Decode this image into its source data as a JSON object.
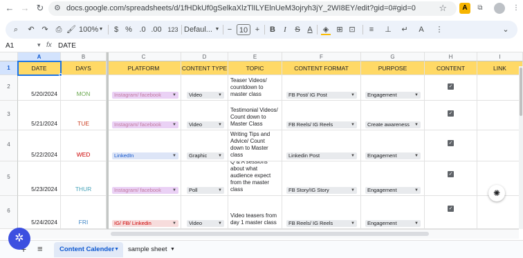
{
  "browser": {
    "url": "docs.google.com/spreadsheets/d/1fHDkUf0gSelkaXlzTlILYElnUeM3ojryh3jY_2WI8EY/edit?gid=0#gid=0"
  },
  "toolbar": {
    "zoom": "100%",
    "currency": "$",
    "percent": "%",
    "decrease_decimal": ".0",
    "increase_decimal": ".00",
    "number_format": "123",
    "font": "Defaul...",
    "font_size": "10"
  },
  "formula_bar": {
    "cell_ref": "A1",
    "content": "DATE"
  },
  "columns": [
    {
      "letter": "A",
      "header": "DATE"
    },
    {
      "letter": "B",
      "header": "DAYS"
    },
    {
      "letter": "C",
      "header": "PLATFORM"
    },
    {
      "letter": "D",
      "header": "CONTENT TYPE"
    },
    {
      "letter": "E",
      "header": "TOPIC"
    },
    {
      "letter": "F",
      "header": "CONTENT FORMAT"
    },
    {
      "letter": "G",
      "header": "PURPOSE"
    },
    {
      "letter": "H",
      "header": "CONTENT STATUS"
    },
    {
      "letter": "I",
      "header": "LINK"
    }
  ],
  "rows": [
    {
      "num": "2",
      "date": "5/20/2024",
      "day": "MON",
      "day_color": "#6aa84f",
      "platform": "Instagram/ facebook",
      "platform_color": "#c27ba0",
      "platform_bg": "#ead1f5",
      "content_type": "Video",
      "topic": "Teaser Videos/ countdown to master class",
      "format": "FB Post/ IG Post",
      "purpose": "Engagement",
      "status_checked": true
    },
    {
      "num": "3",
      "date": "5/21/2024",
      "day": "TUE",
      "day_color": "#cc4125",
      "platform": "Instagram/ facebook",
      "platform_color": "#c27ba0",
      "platform_bg": "#ead1f5",
      "content_type": "Video",
      "topic": "Testimonial Videos/ Count down to Master Class",
      "format": "FB Reels/ IG Reels",
      "purpose": "Create awareness",
      "status_checked": true
    },
    {
      "num": "4",
      "date": "5/22/2024",
      "day": "WED",
      "day_color": "#cc0000",
      "platform": "LinkedIn",
      "platform_color": "#1155cc",
      "platform_bg": "#dde5f7",
      "content_type": "Graphic",
      "topic": "Writing Tips and Advice/ Count down to Master class",
      "format": "Linkedin Post",
      "purpose": "Engagement",
      "status_checked": true
    },
    {
      "num": "5",
      "date": "5/23/2024",
      "day": "THUR",
      "day_color": "#45a2b8",
      "platform": "Instagram/ facebook",
      "platform_color": "#c27ba0",
      "platform_bg": "#ead1f5",
      "content_type": "Poll",
      "topic": "Q & A sessions about what audience expect from the master class",
      "format": "FB Story/IG Story",
      "purpose": "Engagement",
      "status_checked": true
    },
    {
      "num": "6",
      "date": "5/24/2024",
      "day": "FRI",
      "day_color": "#3d85c6",
      "platform": "IG/ FB/ Linkedin",
      "platform_color": "#cc0000",
      "platform_bg": "#f7dcdc",
      "content_type": "Video",
      "topic": "Video teasers from day 1 master class",
      "format": "FB Reels/ IG Reels",
      "purpose": "Engagement",
      "status_checked": true
    }
  ],
  "sheets": {
    "add_label": "+",
    "all_sheets_label": "≡",
    "tab1": "Content Calender",
    "tab2": "sample sheet"
  },
  "colors": {
    "header_fill": "#ffd966",
    "selection": "#1a73e8",
    "fab": "#3c4fe0"
  }
}
